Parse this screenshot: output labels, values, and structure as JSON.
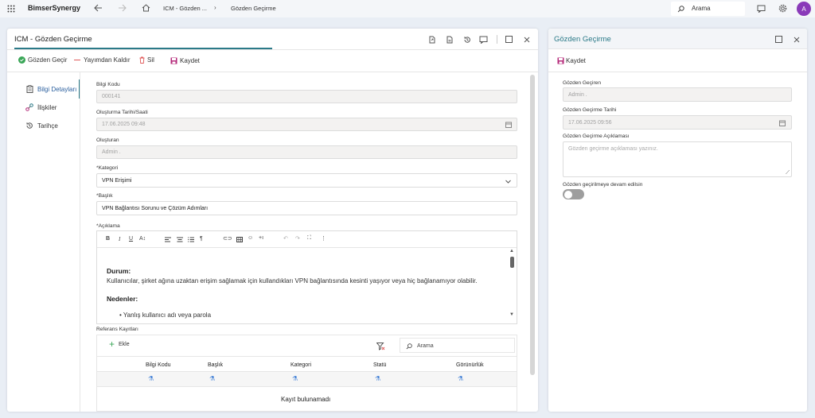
{
  "app": {
    "name": "BimserSynergy",
    "breadcrumb_1": "ICM - Gözden ...",
    "breadcrumb_sep": "›",
    "breadcrumb_2": "Gözden Geçirme"
  },
  "search": {
    "label": "Arama"
  },
  "user": {
    "initial": "A"
  },
  "main_panel": {
    "title": "ICM - Gözden Geçirme",
    "toolbar": {
      "review": "Gözden Geçir",
      "unpublish": "Yayımdan Kaldır",
      "delete": "Sil",
      "save": "Kaydet"
    },
    "nav": {
      "details": "Bilgi Detayları",
      "relations": "İlişkiler",
      "history": "Tarihçe"
    },
    "form": {
      "code_label": "Bilgi Kodu",
      "code_value": "000141",
      "created_label": "Oluşturma Tarihi/Saati",
      "created_value": "17.06.2025 09:48",
      "creator_label": "Oluşturan",
      "creator_value": "Admin .",
      "category_label": "*Kategori",
      "category_value": "VPN Erişimi",
      "title_label": "*Başlık",
      "title_value": "VPN Bağlantısı Sorunu ve Çözüm Adımları",
      "desc_label": "*Açıklama",
      "editor": {
        "h_status": "Durum:",
        "p_status": "Kullanıcılar, şirket ağına uzaktan erişim sağlamak için kullandıkları VPN bağlantısında kesinti yaşıyor veya hiç bağlanamıyor olabilir.",
        "h_reasons": "Nedenler:",
        "li_1": "Yanlış kullanıcı adı veya parola"
      },
      "refs_label": "Referans Kayıtları",
      "refs_add": "Ekle",
      "refs_search": "Arama",
      "refs_cols": {
        "code": "Bilgi Kodu",
        "title": "Başlık",
        "category": "Kategori",
        "status": "Statü",
        "visibility": "Görünürlük"
      },
      "refs_empty": "Kayıt bulunamadı"
    }
  },
  "side_panel": {
    "title": "Gözden Geçirme",
    "save": "Kaydet",
    "reviewer_label": "Gözden Geçiren",
    "reviewer_value": "Admin .",
    "date_label": "Gözden Geçirme Tarihi",
    "date_value": "17.06.2025 09:56",
    "note_label": "Gözden Geçirme Açıklaması",
    "note_placeholder": "Gözden geçirme açıklaması yazınız.",
    "continue_label": "Gözden geçirilmeye devam edilsin"
  },
  "colors": {
    "accent": "#2b7a88",
    "save": "#b4297a",
    "ok": "#3aa657",
    "danger": "#e05a5a"
  }
}
